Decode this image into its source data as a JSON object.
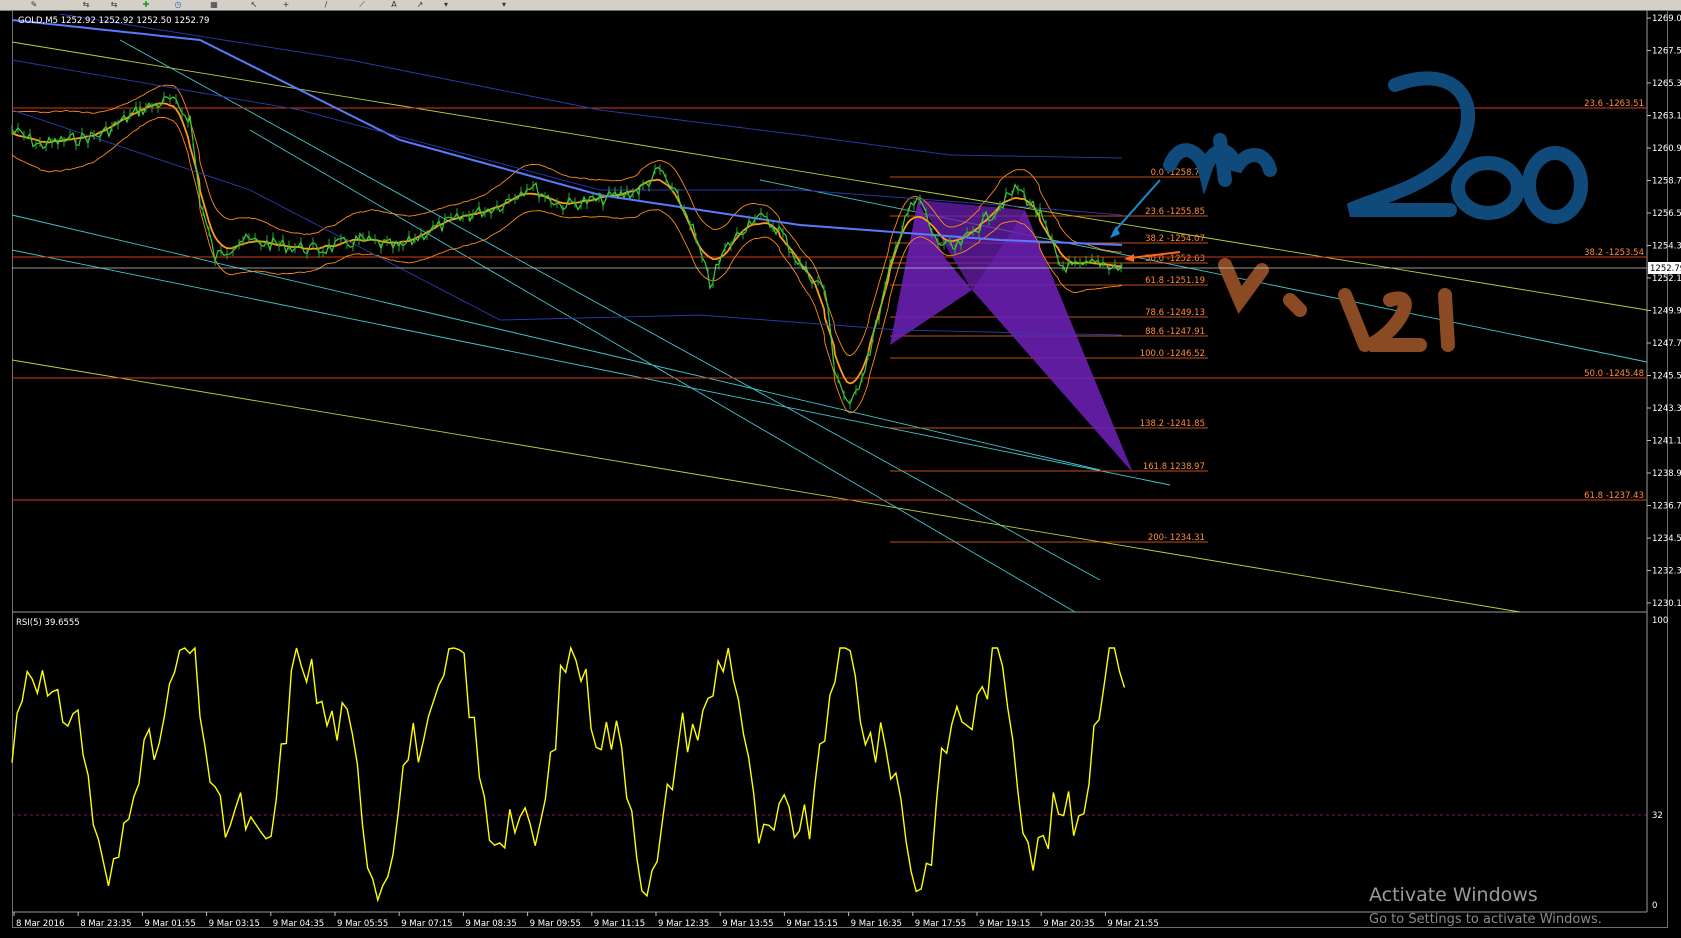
{
  "window": {
    "symbol_info": "GOLD,M5  1252.92 1252.92 1252.50 1252.79"
  },
  "price_axis": {
    "labels": [
      "1269.07",
      "1267.52",
      "1265.33",
      "1263.10",
      "1260.93",
      "1258.73",
      "1256.53",
      "1254.33",
      "1252.13",
      "1249.93",
      "1247.73",
      "1245.53",
      "1243.33",
      "1241.13",
      "1238.93",
      "1236.73",
      "1234.53",
      "1232.33",
      "1230.13"
    ]
  },
  "current_price": "1252.79",
  "fibonacci_left": [
    {
      "label": "0.0 -1258.73"
    },
    {
      "label": "23.6 -1255.85"
    },
    {
      "label": "38.2 -1254.07"
    },
    {
      "label": "50.0 -1252.63"
    },
    {
      "label": "61.8 -1251.19"
    },
    {
      "label": "78.6 -1249.13"
    },
    {
      "label": "88.6 -1247.91"
    },
    {
      "label": "100.0 -1246.52"
    },
    {
      "label": "138.2 -1241.85"
    },
    {
      "label": "161.8 1238.97"
    },
    {
      "label": "200- 1234.31"
    }
  ],
  "fibonacci_right": [
    {
      "label": "23.6 -1263.51"
    },
    {
      "label": "38.2 -1253.54"
    },
    {
      "label": "50.0 -1245.48"
    },
    {
      "label": "61.8 -1237.43"
    }
  ],
  "rsi": {
    "header": "RSI(5) 39.6555",
    "axis": [
      "100",
      "32",
      "0"
    ]
  },
  "time_axis": [
    "8 Mar 2016",
    "8 Mar 23:35",
    "9 Mar 01:55",
    "9 Mar 03:15",
    "9 Mar 04:35",
    "9 Mar 05:55",
    "9 Mar 07:15",
    "9 Mar 08:35",
    "9 Mar 09:55",
    "9 Mar 11:15",
    "9 Mar 12:35",
    "9 Mar 13:55",
    "9 Mar 15:15",
    "9 Mar 16:35",
    "9 Mar 17:55",
    "9 Mar 19:15",
    "9 Mar 20:35",
    "9 Mar 21:55"
  ],
  "watermark": {
    "line1": "Activate Windows",
    "line2": "Go to Settings to activate Windows."
  },
  "colors": {
    "price_line": "#3cd23c",
    "rsi_line": "#ffff00",
    "fib": "#ff6a1a",
    "ma": "#ff9a1a",
    "ma200": "#5a7aff",
    "pattern": "#6a1fb0",
    "annotation_blue": "#0f4a7a",
    "annotation_brown": "#8a4a24"
  }
}
